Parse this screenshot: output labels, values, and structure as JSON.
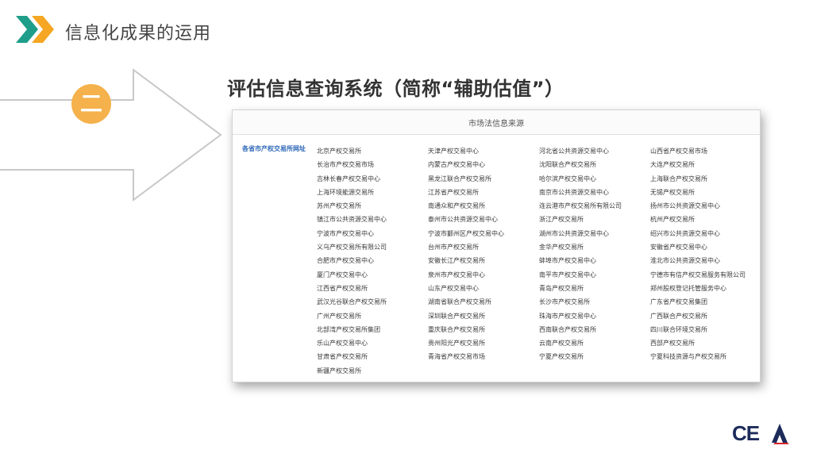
{
  "header": {
    "title": "信息化成果的运用"
  },
  "badge": {
    "text": "二"
  },
  "section": {
    "title": "评估信息查询系统（简称“辅助估值”）"
  },
  "panel": {
    "header": "市场法信息来源",
    "row_label": "各省市产权交易所网址",
    "exchanges": [
      "北京产权交易所",
      "天津产权交易中心",
      "河北省公共资源交易中心",
      "山西省产权交易市场",
      "长治市产权交易市场",
      "内蒙古产权交易中心",
      "沈阳联合产权交易所",
      "大连产权交易所",
      "吉林长春产权交易中心",
      "黑龙江联合产权交易所",
      "哈尔滨产权交易中心",
      "上海联合产权交易所",
      "上海环境能源交易所",
      "江苏省产权交易所",
      "南京市公共资源交易中心",
      "无锡产权交易所",
      "苏州产权交易所",
      "南通众和产权交易所",
      "连云港市产权交易所有限公司",
      "扬州市公共资源交易中心",
      "镇江市公共资源交易中心",
      "泰州市公共资源交易中心",
      "浙江产权交易所",
      "杭州产权交易所",
      "宁波市产权交易中心",
      "宁波市鄞州区产权交易中心",
      "湖州市公共资源交易中心",
      "绍兴市公共资源交易中心",
      "义乌产权交易所有限公司",
      "台州市产权交易所",
      "金华产权交易所",
      "安徽省产权交易中心",
      "合肥市产权交易中心",
      "安徽长江产权交易所",
      "蚌埠市产权交易中心",
      "淮北市公共资源交易中心",
      "厦门产权交易中心",
      "泉州市产权交易中心",
      "南平市产权交易中心",
      "宁德市有信产权交易服务有限公司",
      "江西省产权交易所",
      "山东产权交易中心",
      "青岛产权交易所",
      "郑州股权登记托管服务中心",
      "武汉光谷联合产权交易所",
      "湖南省联合产权交易所",
      "长沙市产权交易所",
      "广东省产权交易集团",
      "广州产权交易所",
      "深圳联合产权交易所",
      "珠海市产权交易中心",
      "广西联合产权交易所",
      "北部湾产权交易所集团",
      "重庆联合产权交易所",
      "西南联合产权交易所",
      "四川联合环境交易所",
      "乐山产权交易中心",
      "贵州阳光产权交易所",
      "云南产权交易所",
      "西部产权交易所",
      "甘肃省产权交易所",
      "青海省产权交易市场",
      "宁夏产权交易所",
      "宁夏科技资源与产权交易所",
      "新疆产权交易所"
    ]
  },
  "logo": {
    "text": "CEA"
  },
  "colors": {
    "accent_orange": "#f5b14b",
    "chevron_green": "#1e9e8a",
    "link_blue": "#2c67b8"
  }
}
